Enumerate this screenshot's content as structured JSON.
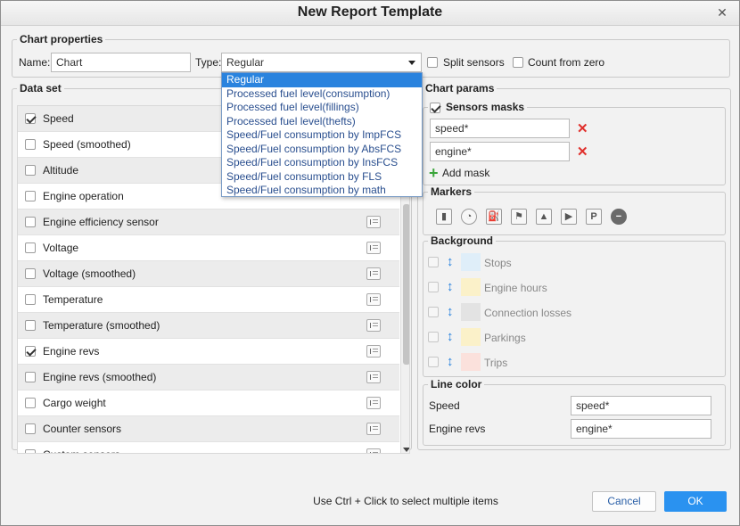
{
  "window": {
    "title": "New Report Template",
    "close_icon": "close-icon"
  },
  "chart_properties": {
    "legend": "Chart properties",
    "name_label": "Name:",
    "name_value": "Chart",
    "type_label": "Type:",
    "type_value": "Regular",
    "split_sensors_label": "Split sensors",
    "split_sensors_checked": false,
    "count_from_zero_label": "Count from zero",
    "count_from_zero_checked": false
  },
  "type_dropdown": {
    "options": [
      "Regular",
      "Processed fuel level(consumption)",
      "Processed fuel level(fillings)",
      "Processed fuel level(thefts)",
      "Speed/Fuel consumption by ImpFCS",
      "Speed/Fuel consumption by AbsFCS",
      "Speed/Fuel consumption by InsFCS",
      "Speed/Fuel consumption by FLS",
      "Speed/Fuel consumption by math"
    ],
    "selected_index": 0
  },
  "data_set": {
    "legend": "Data set",
    "items": [
      {
        "label": "Speed",
        "checked": true,
        "icon": false
      },
      {
        "label": "Speed (smoothed)",
        "checked": false,
        "icon": false
      },
      {
        "label": "Altitude",
        "checked": false,
        "icon": false
      },
      {
        "label": "Engine operation",
        "checked": false,
        "icon": false
      },
      {
        "label": "Engine efficiency sensor",
        "checked": false,
        "icon": true
      },
      {
        "label": "Voltage",
        "checked": false,
        "icon": true
      },
      {
        "label": "Voltage (smoothed)",
        "checked": false,
        "icon": true
      },
      {
        "label": "Temperature",
        "checked": false,
        "icon": true
      },
      {
        "label": "Temperature (smoothed)",
        "checked": false,
        "icon": true
      },
      {
        "label": "Engine revs",
        "checked": true,
        "icon": true
      },
      {
        "label": "Engine revs (smoothed)",
        "checked": false,
        "icon": true
      },
      {
        "label": "Cargo weight",
        "checked": false,
        "icon": true
      },
      {
        "label": "Counter sensors",
        "checked": false,
        "icon": true
      },
      {
        "label": "Custom sensors",
        "checked": false,
        "icon": true
      }
    ]
  },
  "chart_params": {
    "legend": "Chart params",
    "sensors_masks": {
      "legend": "Sensors masks",
      "checked": true,
      "masks": [
        "speed*",
        "engine*"
      ],
      "add_mask_label": "Add mask"
    },
    "markers": {
      "legend": "Markers",
      "icons": [
        "fuel-can-icon",
        "gauge-icon",
        "fuel-pump-icon",
        "flag-icon",
        "image-icon",
        "video-icon",
        "parking-icon",
        "no-entry-icon"
      ]
    },
    "background": {
      "legend": "Background",
      "items": [
        {
          "label": "Stops",
          "color": "#dfeef9"
        },
        {
          "label": "Engine hours",
          "color": "#fbf1c9"
        },
        {
          "label": "Connection losses",
          "color": "#e3e3e3"
        },
        {
          "label": "Parkings",
          "color": "#fbf1c9"
        },
        {
          "label": "Trips",
          "color": "#fbe1dc"
        }
      ]
    },
    "line_color": {
      "legend": "Line color",
      "rows": [
        {
          "label": "Speed",
          "value": "speed*"
        },
        {
          "label": "Engine revs",
          "value": "engine*"
        }
      ]
    }
  },
  "footer": {
    "hint": "Use Ctrl + Click to select multiple items",
    "cancel_label": "Cancel",
    "ok_label": "OK"
  }
}
